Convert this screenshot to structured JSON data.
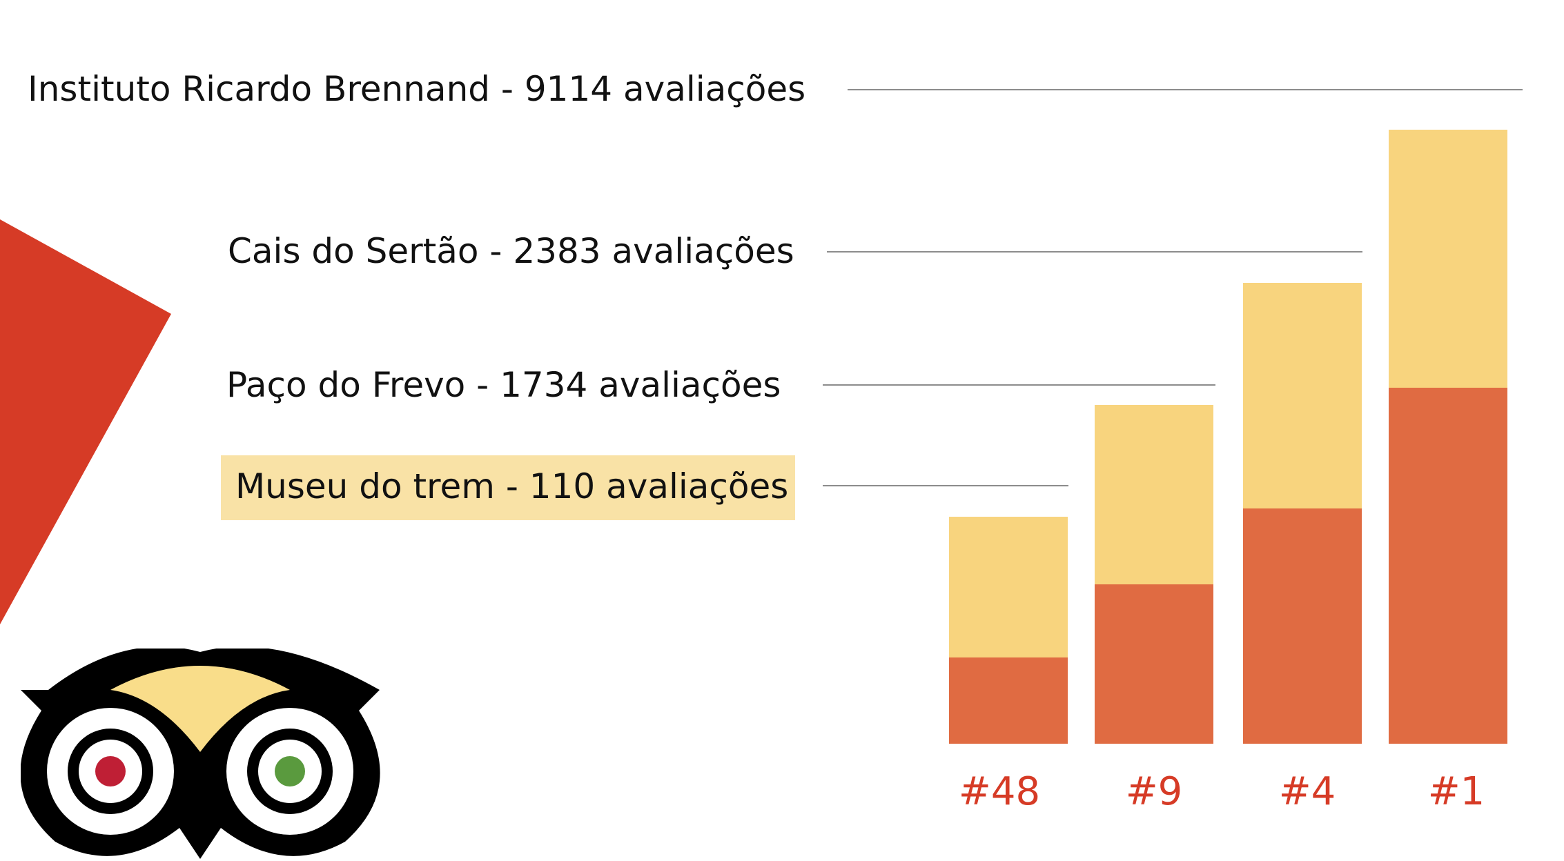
{
  "colors": {
    "accent_red": "#d63b26",
    "bar_light": "#f8d47e",
    "bar_dark": "#e06b42",
    "highlight_bg": "#f9e2a6",
    "rank_text": "#d63b26",
    "owl_red": "#bf1f35",
    "owl_green": "#5a9a3e",
    "owl_yellow": "#f9dd8a"
  },
  "labels": [
    {
      "text": "Instituto Ricardo Brennand - 9114 avaliações"
    },
    {
      "text": "Cais do Sertão - 2383 avaliações"
    },
    {
      "text": "Paço do Frevo - 1734 avaliações"
    },
    {
      "text": "Museu do trem - 110 avaliações"
    }
  ],
  "bars": [
    {
      "rank": "#48",
      "total_fraction": 0.37,
      "dark_fraction": 0.38
    },
    {
      "rank": "#9",
      "total_fraction": 0.552,
      "dark_fraction": 0.47
    },
    {
      "rank": "#4",
      "total_fraction": 0.75,
      "dark_fraction": 0.51
    },
    {
      "rank": "#1",
      "total_fraction": 1.0,
      "dark_fraction": 0.58
    }
  ],
  "icons": {
    "corner_shape": "red-triangle-icon",
    "logo": "tripadvisor-owl-logo-icon"
  }
}
